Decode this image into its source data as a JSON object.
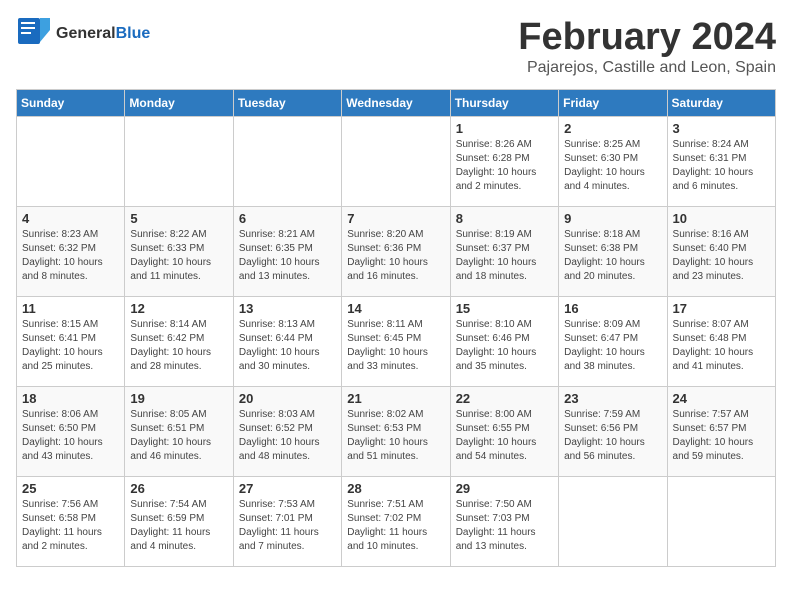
{
  "header": {
    "logo_general": "General",
    "logo_blue": "Blue",
    "month": "February 2024",
    "location": "Pajarejos, Castille and Leon, Spain"
  },
  "weekdays": [
    "Sunday",
    "Monday",
    "Tuesday",
    "Wednesday",
    "Thursday",
    "Friday",
    "Saturday"
  ],
  "weeks": [
    [
      {
        "day": "",
        "info": ""
      },
      {
        "day": "",
        "info": ""
      },
      {
        "day": "",
        "info": ""
      },
      {
        "day": "",
        "info": ""
      },
      {
        "day": "1",
        "info": "Sunrise: 8:26 AM\nSunset: 6:28 PM\nDaylight: 10 hours\nand 2 minutes."
      },
      {
        "day": "2",
        "info": "Sunrise: 8:25 AM\nSunset: 6:30 PM\nDaylight: 10 hours\nand 4 minutes."
      },
      {
        "day": "3",
        "info": "Sunrise: 8:24 AM\nSunset: 6:31 PM\nDaylight: 10 hours\nand 6 minutes."
      }
    ],
    [
      {
        "day": "4",
        "info": "Sunrise: 8:23 AM\nSunset: 6:32 PM\nDaylight: 10 hours\nand 8 minutes."
      },
      {
        "day": "5",
        "info": "Sunrise: 8:22 AM\nSunset: 6:33 PM\nDaylight: 10 hours\nand 11 minutes."
      },
      {
        "day": "6",
        "info": "Sunrise: 8:21 AM\nSunset: 6:35 PM\nDaylight: 10 hours\nand 13 minutes."
      },
      {
        "day": "7",
        "info": "Sunrise: 8:20 AM\nSunset: 6:36 PM\nDaylight: 10 hours\nand 16 minutes."
      },
      {
        "day": "8",
        "info": "Sunrise: 8:19 AM\nSunset: 6:37 PM\nDaylight: 10 hours\nand 18 minutes."
      },
      {
        "day": "9",
        "info": "Sunrise: 8:18 AM\nSunset: 6:38 PM\nDaylight: 10 hours\nand 20 minutes."
      },
      {
        "day": "10",
        "info": "Sunrise: 8:16 AM\nSunset: 6:40 PM\nDaylight: 10 hours\nand 23 minutes."
      }
    ],
    [
      {
        "day": "11",
        "info": "Sunrise: 8:15 AM\nSunset: 6:41 PM\nDaylight: 10 hours\nand 25 minutes."
      },
      {
        "day": "12",
        "info": "Sunrise: 8:14 AM\nSunset: 6:42 PM\nDaylight: 10 hours\nand 28 minutes."
      },
      {
        "day": "13",
        "info": "Sunrise: 8:13 AM\nSunset: 6:44 PM\nDaylight: 10 hours\nand 30 minutes."
      },
      {
        "day": "14",
        "info": "Sunrise: 8:11 AM\nSunset: 6:45 PM\nDaylight: 10 hours\nand 33 minutes."
      },
      {
        "day": "15",
        "info": "Sunrise: 8:10 AM\nSunset: 6:46 PM\nDaylight: 10 hours\nand 35 minutes."
      },
      {
        "day": "16",
        "info": "Sunrise: 8:09 AM\nSunset: 6:47 PM\nDaylight: 10 hours\nand 38 minutes."
      },
      {
        "day": "17",
        "info": "Sunrise: 8:07 AM\nSunset: 6:48 PM\nDaylight: 10 hours\nand 41 minutes."
      }
    ],
    [
      {
        "day": "18",
        "info": "Sunrise: 8:06 AM\nSunset: 6:50 PM\nDaylight: 10 hours\nand 43 minutes."
      },
      {
        "day": "19",
        "info": "Sunrise: 8:05 AM\nSunset: 6:51 PM\nDaylight: 10 hours\nand 46 minutes."
      },
      {
        "day": "20",
        "info": "Sunrise: 8:03 AM\nSunset: 6:52 PM\nDaylight: 10 hours\nand 48 minutes."
      },
      {
        "day": "21",
        "info": "Sunrise: 8:02 AM\nSunset: 6:53 PM\nDaylight: 10 hours\nand 51 minutes."
      },
      {
        "day": "22",
        "info": "Sunrise: 8:00 AM\nSunset: 6:55 PM\nDaylight: 10 hours\nand 54 minutes."
      },
      {
        "day": "23",
        "info": "Sunrise: 7:59 AM\nSunset: 6:56 PM\nDaylight: 10 hours\nand 56 minutes."
      },
      {
        "day": "24",
        "info": "Sunrise: 7:57 AM\nSunset: 6:57 PM\nDaylight: 10 hours\nand 59 minutes."
      }
    ],
    [
      {
        "day": "25",
        "info": "Sunrise: 7:56 AM\nSunset: 6:58 PM\nDaylight: 11 hours\nand 2 minutes."
      },
      {
        "day": "26",
        "info": "Sunrise: 7:54 AM\nSunset: 6:59 PM\nDaylight: 11 hours\nand 4 minutes."
      },
      {
        "day": "27",
        "info": "Sunrise: 7:53 AM\nSunset: 7:01 PM\nDaylight: 11 hours\nand 7 minutes."
      },
      {
        "day": "28",
        "info": "Sunrise: 7:51 AM\nSunset: 7:02 PM\nDaylight: 11 hours\nand 10 minutes."
      },
      {
        "day": "29",
        "info": "Sunrise: 7:50 AM\nSunset: 7:03 PM\nDaylight: 11 hours\nand 13 minutes."
      },
      {
        "day": "",
        "info": ""
      },
      {
        "day": "",
        "info": ""
      }
    ]
  ]
}
